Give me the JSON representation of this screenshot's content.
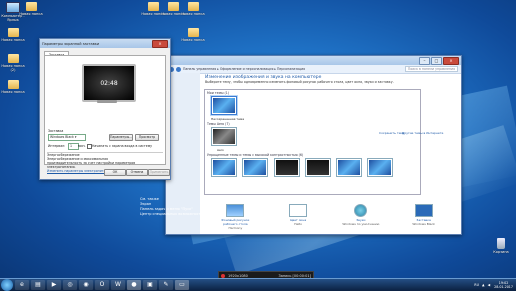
{
  "desktop_icons": [
    {
      "label": "Компьютер - Ярлык",
      "type": "pc"
    },
    {
      "label": "Новая папка",
      "type": "folder"
    },
    {
      "label": "Новая папка (2)",
      "type": "folder"
    },
    {
      "label": "Новая папка",
      "type": "folder"
    },
    {
      "label": "Новая папка",
      "type": "folder"
    },
    {
      "label": "Новая папка",
      "type": "folder"
    },
    {
      "label": "Новая папка",
      "type": "folder"
    },
    {
      "label": "Новая папка",
      "type": "folder"
    },
    {
      "label": "Новая папка",
      "type": "folder"
    },
    {
      "label": "Корзина",
      "type": "bin"
    }
  ],
  "personalization": {
    "address": "Панель управления ▸ Оформление и персонализация ▸ Персонализация",
    "search_placeholder": "Поиск в панели управления",
    "title": "Изменение изображения и звука на компьютере",
    "subtitle": "Выберите тему, чтобы одновременно изменить фоновый рисунок рабочего стола, цвет окна, звуки и заставку.",
    "section_my": "Мои темы (1)",
    "my_theme_label": "Несохраненная тема",
    "save_link": "Сохранить тему",
    "online_link": "Другие темы в Интернете",
    "section_aero": "Темы Aero (7)",
    "aero_label": "Aero",
    "section_basic": "Упрощенные темы и темы с высокой контрастностью (6)",
    "see_also_title": "См. также",
    "see_also": [
      "Экран",
      "Панель задач и меню \"Пуск\"",
      "Центр специальных возможностей"
    ],
    "bottom_items": [
      {
        "label": "Фоновый рисунок рабочего стола",
        "sub": "Harmony"
      },
      {
        "label": "Цвет окна",
        "sub": "Небо"
      },
      {
        "label": "Звуки",
        "sub": "Windows по умолчанию"
      },
      {
        "label": "Заставка",
        "sub": "Windows Black"
      }
    ]
  },
  "saver_dialog": {
    "title": "Параметры экранной заставки",
    "tab": "Заставка",
    "preview_time": "02:48",
    "saver_label": "Заставка",
    "saver_value": "Windows Black",
    "params_button": "Параметры...",
    "preview_button": "Просмотр",
    "interval_label": "Интервал:",
    "interval_value": "1",
    "interval_unit": "мин.",
    "logon_check": "Начинать с экрана входа в систему",
    "power_title": "Энергосбережение",
    "power_text": "Энергосбережение и максимальная производительность за счет настройки параметров электропитания.",
    "power_link": "Изменить параметры электропитания",
    "ok": "ОК",
    "cancel": "Отмена",
    "apply": "Применить"
  },
  "recorder": {
    "resolution": "1920x1080",
    "status": "Запись [00:00:01]"
  },
  "taskbar": {
    "apps": [
      "IE",
      "Проводник",
      "Media",
      "Chrome",
      "Firefox",
      "Opera",
      "Word",
      "Record",
      "Img",
      "Paint",
      "Window"
    ],
    "lang": "RU",
    "time": "19:02",
    "date": "28.01.2017"
  }
}
